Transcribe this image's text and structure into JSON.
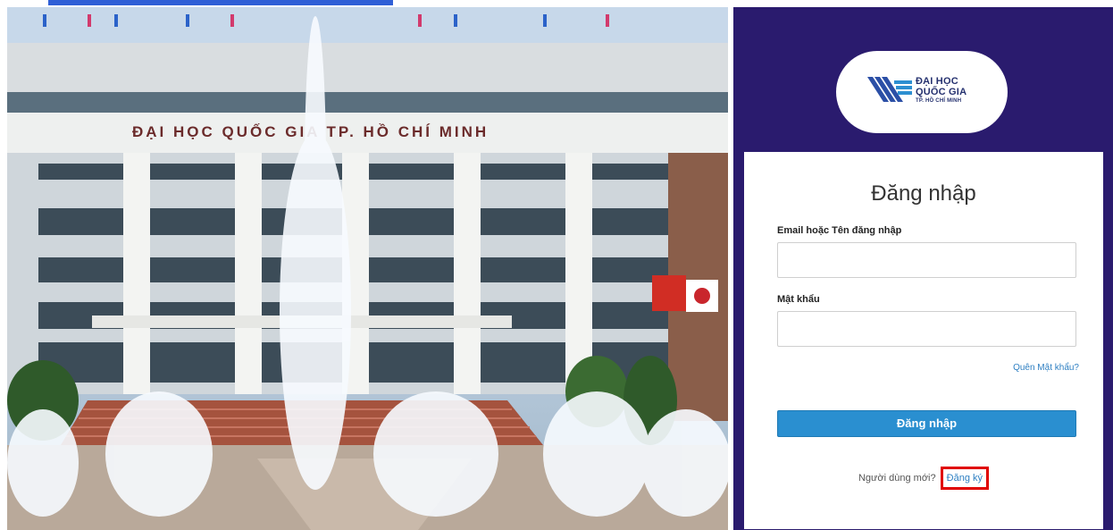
{
  "photo": {
    "building_sign": "ĐẠI HỌC QUỐC GIA TP. HỒ CHÍ MINH"
  },
  "logo": {
    "line1": "ĐẠI HỌC",
    "line2": "QUỐC GIA",
    "line3": "TP. HỒ CHÍ MINH"
  },
  "form": {
    "title": "Đăng nhập",
    "username_label": "Email hoặc Tên đăng nhập",
    "username_value": "",
    "password_label": "Mật khẩu",
    "password_value": "",
    "forgot_password": "Quên Mật khẩu?",
    "submit_label": "Đăng nhập",
    "new_user_text": "Người dùng mới?",
    "register_link": "Đăng ký"
  },
  "colors": {
    "panel_bg": "#2a1b6e",
    "primary_button": "#2a8fd0",
    "link": "#2e7fc2",
    "highlight_box": "#e00000"
  }
}
